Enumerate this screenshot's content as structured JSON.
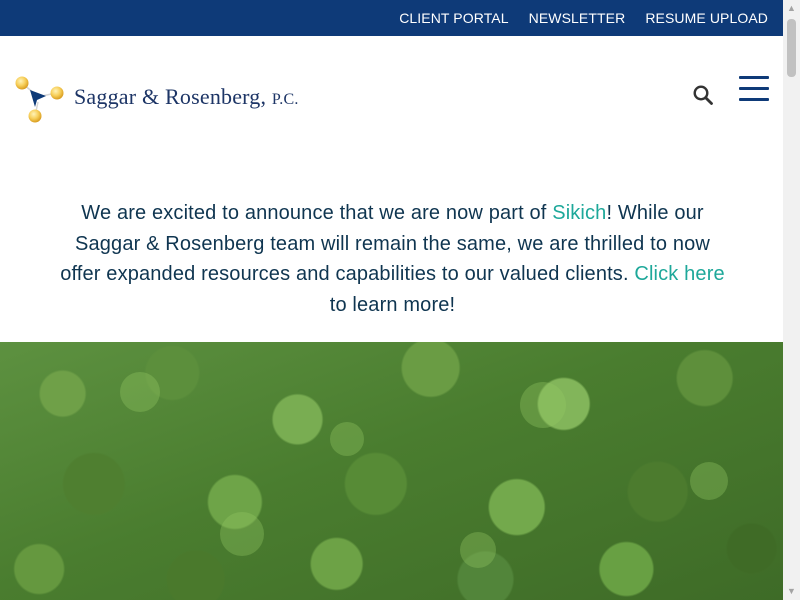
{
  "topbar": {
    "links": [
      {
        "label": "CLIENT PORTAL"
      },
      {
        "label": "NEWSLETTER"
      },
      {
        "label": "RESUME UPLOAD"
      }
    ]
  },
  "header": {
    "logo": {
      "name_part1": "Saggar",
      "ampersand": "&",
      "name_part2": "Rosenberg",
      "suffix": "P.C."
    },
    "search_icon": "search-icon",
    "menu_icon": "hamburger-menu-icon"
  },
  "announcement": {
    "text1": "We are excited to announce that we are now part of ",
    "link1": "Sikich",
    "text2": "! While our Saggar & Rosenberg team will remain the same, we are thrilled to now offer expanded resources and capabilities to our valued clients. ",
    "link2": "Click here",
    "text3": " to learn more!"
  },
  "colors": {
    "brand_navy": "#0e3a78",
    "text_navy": "#0f3550",
    "accent_teal": "#1ea89a",
    "logo_gold": "#f2c24b"
  },
  "hero": {
    "image": "aerial forest canopy"
  }
}
